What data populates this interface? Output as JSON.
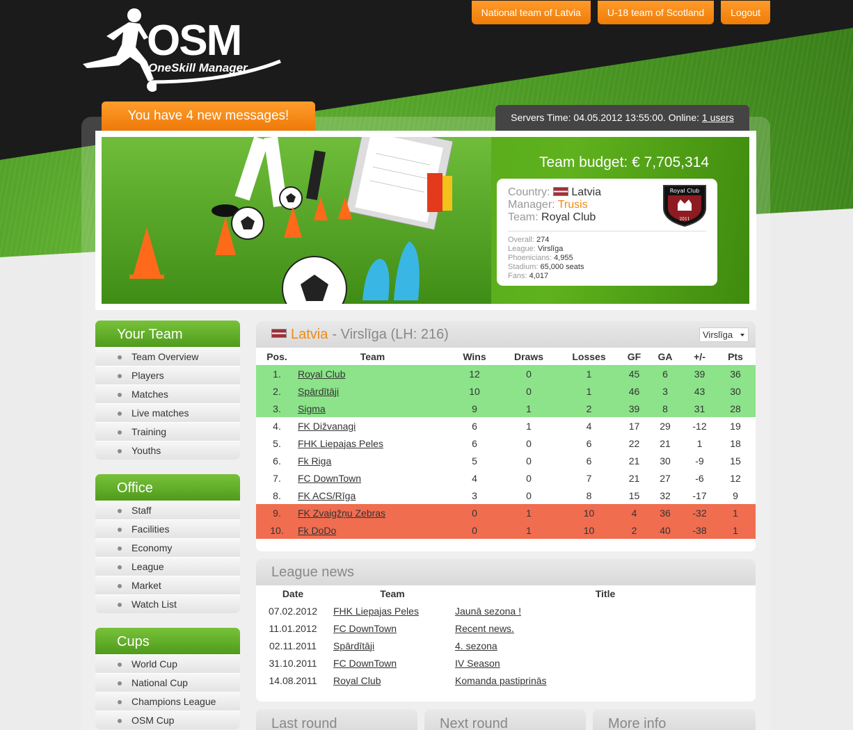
{
  "header": {
    "logo_text": "OSM",
    "logo_subtitle": "OneSkill Manager",
    "nav": [
      {
        "label": "National team of Latvia"
      },
      {
        "label": "U-18 team of Scotland"
      },
      {
        "label": "Logout"
      }
    ]
  },
  "messages_label": "You have 4 new messages!",
  "server": {
    "prefix": "Servers Time: 04.05.2012 13:55:00. Online: ",
    "online_link": "1 users"
  },
  "banner": {
    "budget_label": "Team budget: € 7,705,314",
    "country_label": "Country:",
    "country": "Latvia",
    "manager_label": "Manager:",
    "manager": "Trusis",
    "team_label": "Team:",
    "team": "Royal Club",
    "crest_text": "Royal Club",
    "crest_year": "2011",
    "stats": [
      {
        "label": "Overall:",
        "value": "274"
      },
      {
        "label": "League:",
        "value": "Virslīga"
      },
      {
        "label": "Phoenicians:",
        "value": "4,955"
      },
      {
        "label": "Stadium:",
        "value": "65,000 seats"
      },
      {
        "label": "Fans:",
        "value": "4,017"
      }
    ]
  },
  "sidebar": {
    "your_team": {
      "title": "Your Team",
      "items": [
        "Team Overview",
        "Players",
        "Matches",
        "Live matches",
        "Training",
        "Youths"
      ]
    },
    "office": {
      "title": "Office",
      "items": [
        "Staff",
        "Facilities",
        "Economy",
        "League",
        "Market",
        "Watch List"
      ]
    },
    "cups": {
      "title": "Cups",
      "items": [
        "World Cup",
        "National Cup",
        "Champions League",
        "OSM Cup"
      ]
    }
  },
  "league": {
    "country": "Latvia",
    "title_rest": "- Virslīga (LH: 216)",
    "select_value": "Virslīga",
    "columns": [
      "Pos.",
      "Team",
      "Wins",
      "Draws",
      "Losses",
      "GF",
      "GA",
      "+/-",
      "Pts"
    ],
    "rows": [
      {
        "pos": "1.",
        "team": "Royal Club",
        "wins": "12",
        "draws": "0",
        "losses": "1",
        "gf": "45",
        "ga": "6",
        "diff": "39",
        "pts": "36",
        "zone": "promo"
      },
      {
        "pos": "2.",
        "team": "Spārdītāji",
        "wins": "10",
        "draws": "0",
        "losses": "1",
        "gf": "46",
        "ga": "3",
        "diff": "43",
        "pts": "30",
        "zone": "promo"
      },
      {
        "pos": "3.",
        "team": "Sigma",
        "wins": "9",
        "draws": "1",
        "losses": "2",
        "gf": "39",
        "ga": "8",
        "diff": "31",
        "pts": "28",
        "zone": "promo"
      },
      {
        "pos": "4.",
        "team": "FK Dižvanagi",
        "wins": "6",
        "draws": "1",
        "losses": "4",
        "gf": "17",
        "ga": "29",
        "diff": "-12",
        "pts": "19",
        "zone": ""
      },
      {
        "pos": "5.",
        "team": "FHK Liepajas Peles",
        "wins": "6",
        "draws": "0",
        "losses": "6",
        "gf": "22",
        "ga": "21",
        "diff": "1",
        "pts": "18",
        "zone": ""
      },
      {
        "pos": "6.",
        "team": "Fk Riga",
        "wins": "5",
        "draws": "0",
        "losses": "6",
        "gf": "21",
        "ga": "30",
        "diff": "-9",
        "pts": "15",
        "zone": ""
      },
      {
        "pos": "7.",
        "team": "FC DownTown",
        "wins": "4",
        "draws": "0",
        "losses": "7",
        "gf": "21",
        "ga": "27",
        "diff": "-6",
        "pts": "12",
        "zone": ""
      },
      {
        "pos": "8.",
        "team": "FK ACS/Rīga",
        "wins": "3",
        "draws": "0",
        "losses": "8",
        "gf": "15",
        "ga": "32",
        "diff": "-17",
        "pts": "9",
        "zone": ""
      },
      {
        "pos": "9.",
        "team": "FK Zvaigžņu Zebras",
        "wins": "0",
        "draws": "1",
        "losses": "10",
        "gf": "4",
        "ga": "36",
        "diff": "-32",
        "pts": "1",
        "zone": "releg"
      },
      {
        "pos": "10.",
        "team": "Fk DoDo",
        "wins": "0",
        "draws": "1",
        "losses": "10",
        "gf": "2",
        "ga": "40",
        "diff": "-38",
        "pts": "1",
        "zone": "releg"
      }
    ]
  },
  "news": {
    "title": "League news",
    "columns": [
      "Date",
      "Team",
      "Title"
    ],
    "rows": [
      {
        "date": "07.02.2012",
        "team": "FHK Liepajas Peles",
        "title": "Jaunā sezona !"
      },
      {
        "date": "11.01.2012",
        "team": "FC DownTown",
        "title": "Recent news."
      },
      {
        "date": "02.11.2011",
        "team": "Spārdītāji",
        "title": "4. sezona"
      },
      {
        "date": "31.10.2011",
        "team": "FC DownTown",
        "title": "IV Season"
      },
      {
        "date": "14.08.2011",
        "team": "Royal Club",
        "title": "Komanda pastiprinās"
      }
    ]
  },
  "bottom_panels": [
    "Last round",
    "Next round",
    "More info"
  ],
  "colors": {
    "accent": "#f08a10",
    "green": "#5aab1e",
    "promotion": "#8ce38a",
    "relegation": "#f06d50"
  }
}
